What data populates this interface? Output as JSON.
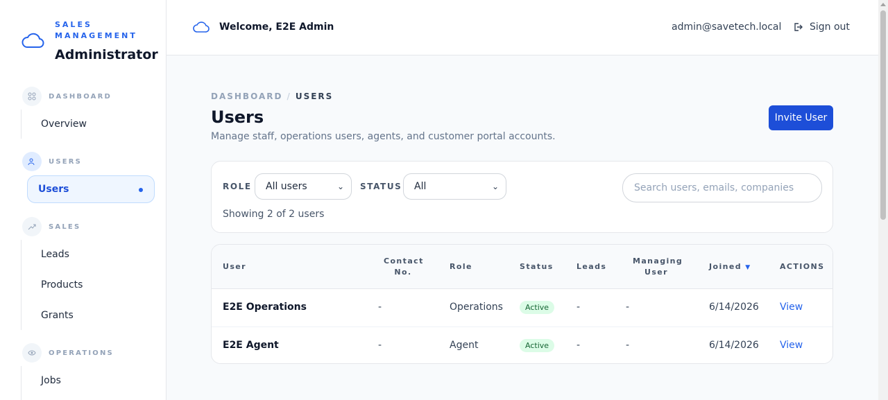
{
  "sidebar": {
    "brand_kicker": "SALES MANAGEMENT",
    "brand_title": "Administrator",
    "sections": [
      {
        "label": "DASHBOARD",
        "icon": "grid-icon",
        "items": [
          {
            "label": "Overview"
          }
        ]
      },
      {
        "label": "USERS",
        "icon": "users-icon",
        "items": [
          {
            "label": "Users",
            "active": true
          }
        ]
      },
      {
        "label": "SALES",
        "icon": "trending-icon",
        "items": [
          {
            "label": "Leads"
          },
          {
            "label": "Products"
          },
          {
            "label": "Grants"
          }
        ]
      },
      {
        "label": "OPERATIONS",
        "icon": "eye-icon",
        "items": [
          {
            "label": "Jobs"
          }
        ]
      }
    ]
  },
  "header": {
    "welcome": "Welcome, E2E Admin",
    "email": "admin@savetech.local",
    "signout": "Sign out"
  },
  "page": {
    "breadcrumb_root": "DASHBOARD",
    "breadcrumb_sep": "/",
    "breadcrumb_current": "USERS",
    "title": "Users",
    "subtitle": "Manage staff, operations users, agents, and customer portal accounts.",
    "invite_label": "Invite User"
  },
  "filters": {
    "role_label": "ROLE",
    "role_value": "All users",
    "status_label": "STATUS",
    "status_value": "All",
    "search_placeholder": "Search users, emails, companies",
    "showing": "Showing 2 of 2 users"
  },
  "table": {
    "headers": {
      "user": "User",
      "contact_1": "Contact",
      "contact_2": "No.",
      "role": "Role",
      "status": "Status",
      "leads": "Leads",
      "managing_1": "Managing",
      "managing_2": "User",
      "joined": "Joined",
      "sort_indicator": "▼",
      "actions": "ACTIONS"
    },
    "rows": [
      {
        "name": "E2E Operations",
        "contact": "-",
        "role": "Operations",
        "status": "Active",
        "leads": "-",
        "managing": "-",
        "joined": "6/14/2026",
        "action": "View"
      },
      {
        "name": "E2E Agent",
        "contact": "-",
        "role": "Agent",
        "status": "Active",
        "leads": "-",
        "managing": "-",
        "joined": "6/14/2026",
        "action": "View"
      }
    ]
  },
  "colors": {
    "accent": "#1d4ed8",
    "link": "#2563eb",
    "badge_bg": "#dcfce7",
    "badge_text": "#166534"
  }
}
